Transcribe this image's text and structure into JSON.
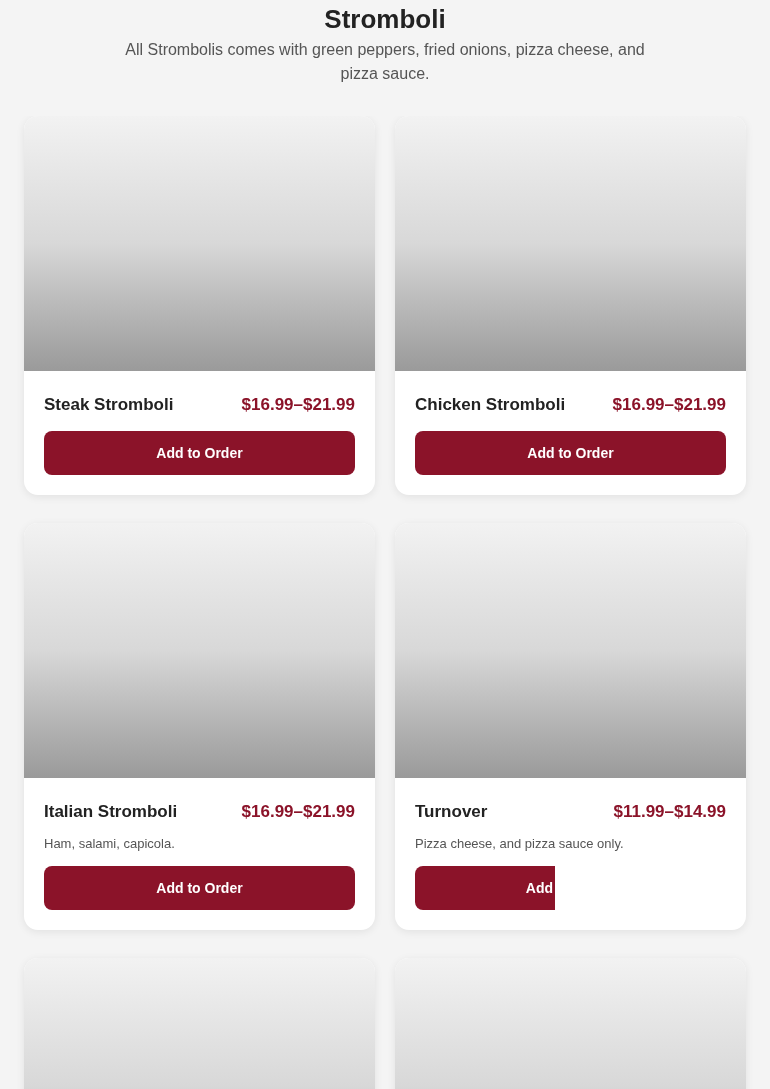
{
  "section": {
    "title": "Stromboli",
    "subtitle": "All Strombolis comes with green peppers, fried onions, pizza cheese, and pizza sauce."
  },
  "items": [
    {
      "kind": "card",
      "name": "Steak Stromboli",
      "price": "$16.99–$21.99",
      "button": "Add to Order",
      "button_cut": false
    },
    {
      "kind": "card",
      "name": "Chicken Stromboli",
      "price": "$16.99–$21.99",
      "button": "Add to Order",
      "button_cut": false
    },
    {
      "kind": "card",
      "name": "Italian Stromboli",
      "price": "$16.99–$21.99",
      "description": "Ham, salami, capicola.",
      "button": "Add to Order",
      "button_cut": false
    },
    {
      "kind": "card",
      "name": "Turnover",
      "price": "$11.99–$14.99",
      "description": "Pizza cheese, and pizza sauce only.",
      "button": "Add",
      "button_cut": true
    },
    {
      "kind": "image-only"
    },
    {
      "kind": "image-only"
    }
  ]
}
